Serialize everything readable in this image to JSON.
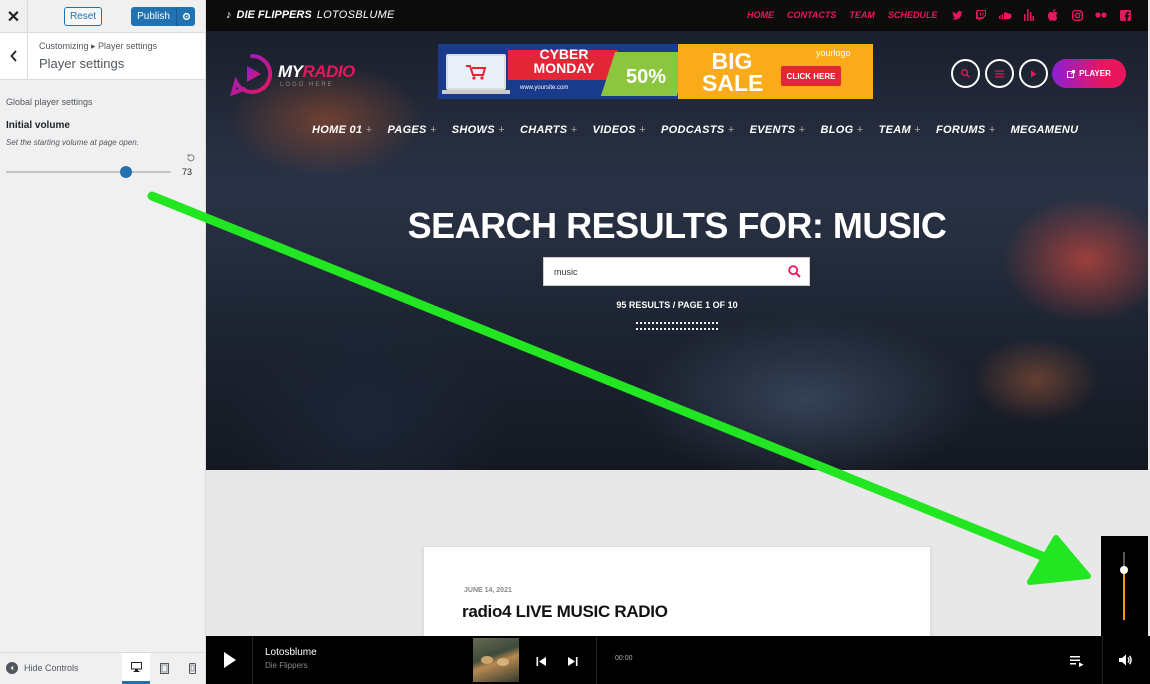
{
  "customizer": {
    "close_icon": "close-icon",
    "reset_label": "Reset",
    "publish_label": "Publish",
    "breadcrumb": "Customizing ▸ Player settings",
    "panel_title": "Player settings",
    "section_title": "Global player settings",
    "setting_title": "Initial volume",
    "setting_description": "Set the starting volume at page open.",
    "volume_value": "73",
    "volume_fraction": 0.73,
    "hide_controls_label": "Hide Controls",
    "devices": [
      "desktop",
      "tablet",
      "mobile"
    ]
  },
  "site": {
    "now_playing": {
      "artist": "DIE FLIPPERS",
      "song": "LOTOSBLUME"
    },
    "top_nav": [
      "HOME",
      "CONTACTS",
      "TEAM",
      "SCHEDULE"
    ],
    "socials": [
      "twitter-icon",
      "twitch-icon",
      "soundcloud-icon",
      "mixcloud-icon",
      "apple-icon",
      "instagram-icon",
      "flickr-icon",
      "facebook-icon"
    ],
    "logo": {
      "part_a": "MY",
      "part_b": "RADIO",
      "tagline": "LOGO HERE"
    },
    "banner": {
      "cyber": "CYBER MONDAY",
      "site": "www.yoursite.com",
      "percent": "50%",
      "big_sale": "BIG SALE",
      "yourlogo": "yourlogo",
      "click_here": "CLICK HERE"
    },
    "player_button": "PLAYER",
    "main_nav": [
      {
        "label": "HOME 01",
        "plus": "+"
      },
      {
        "label": "PAGES",
        "plus": "+"
      },
      {
        "label": "SHOWS",
        "plus": "+"
      },
      {
        "label": "CHARTS",
        "plus": "+"
      },
      {
        "label": "VIDEOS",
        "plus": "+"
      },
      {
        "label": "PODCASTS",
        "plus": "+"
      },
      {
        "label": "EVENTS",
        "plus": "+"
      },
      {
        "label": "BLOG",
        "plus": "+"
      },
      {
        "label": "TEAM",
        "plus": "+"
      },
      {
        "label": "FORUMS",
        "plus": "+"
      },
      {
        "label": "MEGAMENU",
        "plus": ""
      }
    ],
    "search_title": "SEARCH RESULTS FOR: MUSIC",
    "search_value": "music",
    "results_meta": "95 RESULTS / PAGE 1 OF 10",
    "card": {
      "date": "JUNE 14, 2021",
      "title": "radio4 LIVE MUSIC RADIO"
    }
  },
  "player": {
    "track_title": "Lotosblume",
    "track_artist": "Die Flippers",
    "time": "00:00",
    "volume_fraction": 0.73
  },
  "colors": {
    "accent": "#e8175d",
    "wp_blue": "#2271b1",
    "volume_fill": "#f39c12",
    "annotation_arrow": "#22e622"
  }
}
